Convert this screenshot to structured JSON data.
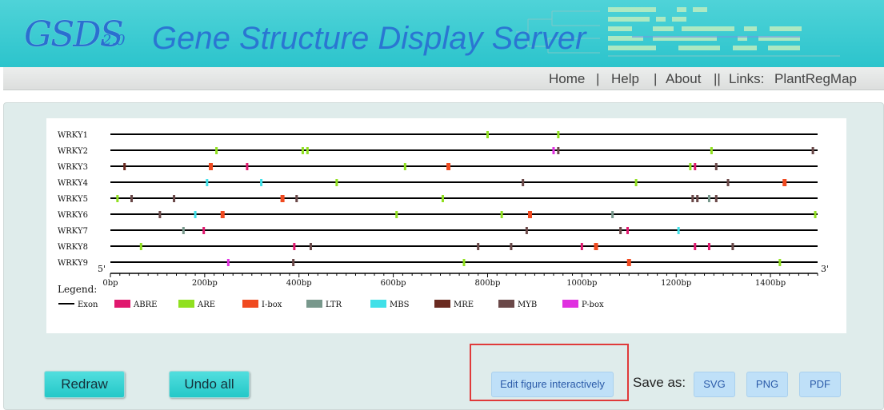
{
  "banner": {
    "logo_main": "GSDS",
    "logo_version": "2.0",
    "title": "Gene Structure Display Server"
  },
  "nav": {
    "home": "Home",
    "help": "Help",
    "about": "About",
    "links_label": "Links:",
    "plantregmap": "PlantRegMap"
  },
  "chart_data": {
    "type": "gene-structure",
    "genes": [
      "WRKY1",
      "WRKY2",
      "WRKY3",
      "WRKY4",
      "WRKY5",
      "WRKY6",
      "WRKY7",
      "WRKY8",
      "WRKY9"
    ],
    "x_range": [
      0,
      1500
    ],
    "x_ticks": [
      0,
      200,
      400,
      600,
      800,
      1000,
      1200,
      1400
    ],
    "x_tick_labels": [
      "0bp",
      "200bp",
      "400bp",
      "600bp",
      "800bp",
      "1000bp",
      "1200bp",
      "1400bp"
    ],
    "five_prime": "5'",
    "three_prime": "3'",
    "legend_title": "Legend:",
    "legend": [
      {
        "name": "Exon",
        "color": "#000000",
        "kind": "line"
      },
      {
        "name": "ABRE",
        "color": "#e0186e",
        "kind": "box"
      },
      {
        "name": "ARE",
        "color": "#90e020",
        "kind": "box"
      },
      {
        "name": "I-box",
        "color": "#f04a20",
        "kind": "box"
      },
      {
        "name": "LTR",
        "color": "#78988c",
        "kind": "box"
      },
      {
        "name": "MBS",
        "color": "#40e0e8",
        "kind": "box"
      },
      {
        "name": "MRE",
        "color": "#6a2a20",
        "kind": "box"
      },
      {
        "name": "MYB",
        "color": "#6a4848",
        "kind": "box"
      },
      {
        "name": "P-box",
        "color": "#e030e0",
        "kind": "box"
      }
    ],
    "features": [
      [
        [
          "ARE",
          800
        ],
        [
          "ARE",
          950
        ]
      ],
      [
        [
          "ARE",
          225
        ],
        [
          "ARE",
          408
        ],
        [
          "ARE",
          418
        ],
        [
          "P-box",
          940
        ],
        [
          "MYB",
          950
        ],
        [
          "ARE",
          1275
        ],
        [
          "MYB",
          1490
        ]
      ],
      [
        [
          "MRE",
          30
        ],
        [
          "I-box",
          213
        ],
        [
          "ABRE",
          290
        ],
        [
          "ARE",
          625
        ],
        [
          "I-box",
          717
        ],
        [
          "ARE",
          1230
        ],
        [
          "ABRE",
          1240
        ],
        [
          "MYB",
          1285
        ]
      ],
      [
        [
          "MBS",
          205
        ],
        [
          "MBS",
          320
        ],
        [
          "ARE",
          480
        ],
        [
          "MYB",
          875
        ],
        [
          "ARE",
          1115
        ],
        [
          "MYB",
          1310
        ],
        [
          "I-box",
          1430
        ]
      ],
      [
        [
          "ARE",
          15
        ],
        [
          "MYB",
          45
        ],
        [
          "MYB",
          135
        ],
        [
          "I-box",
          365
        ],
        [
          "MYB",
          395
        ],
        [
          "ARE",
          705
        ],
        [
          "MYB",
          1235
        ],
        [
          "MYB",
          1245
        ],
        [
          "LTR",
          1270
        ],
        [
          "MYB",
          1285
        ]
      ],
      [
        [
          "MYB",
          105
        ],
        [
          "MBS",
          180
        ],
        [
          "I-box",
          238
        ],
        [
          "ARE",
          607
        ],
        [
          "ARE",
          830
        ],
        [
          "I-box",
          890
        ],
        [
          "LTR",
          1065
        ],
        [
          "ARE",
          1495
        ]
      ],
      [
        [
          "LTR",
          155
        ],
        [
          "ABRE",
          198
        ],
        [
          "MYB",
          883
        ],
        [
          "MYB",
          1082
        ],
        [
          "ABRE",
          1097
        ],
        [
          "MBS",
          1205
        ]
      ],
      [
        [
          "ARE",
          65
        ],
        [
          "ABRE",
          390
        ],
        [
          "MYB",
          425
        ],
        [
          "MYB",
          780
        ],
        [
          "MYB",
          850
        ],
        [
          "ABRE",
          1000
        ],
        [
          "I-box",
          1030
        ],
        [
          "ABRE",
          1240
        ],
        [
          "ABRE",
          1270
        ],
        [
          "MYB",
          1320
        ]
      ],
      [
        [
          "P-box",
          250
        ],
        [
          "MYB",
          388
        ],
        [
          "ARE",
          750
        ],
        [
          "I-box",
          1100
        ],
        [
          "ARE",
          1420
        ]
      ]
    ]
  },
  "actions": {
    "redraw": "Redraw",
    "undo_all": "Undo all",
    "edit_interactive": "Edit figure interactively",
    "save_as": "Save as:",
    "svg": "SVG",
    "png": "PNG",
    "pdf": "PDF"
  }
}
